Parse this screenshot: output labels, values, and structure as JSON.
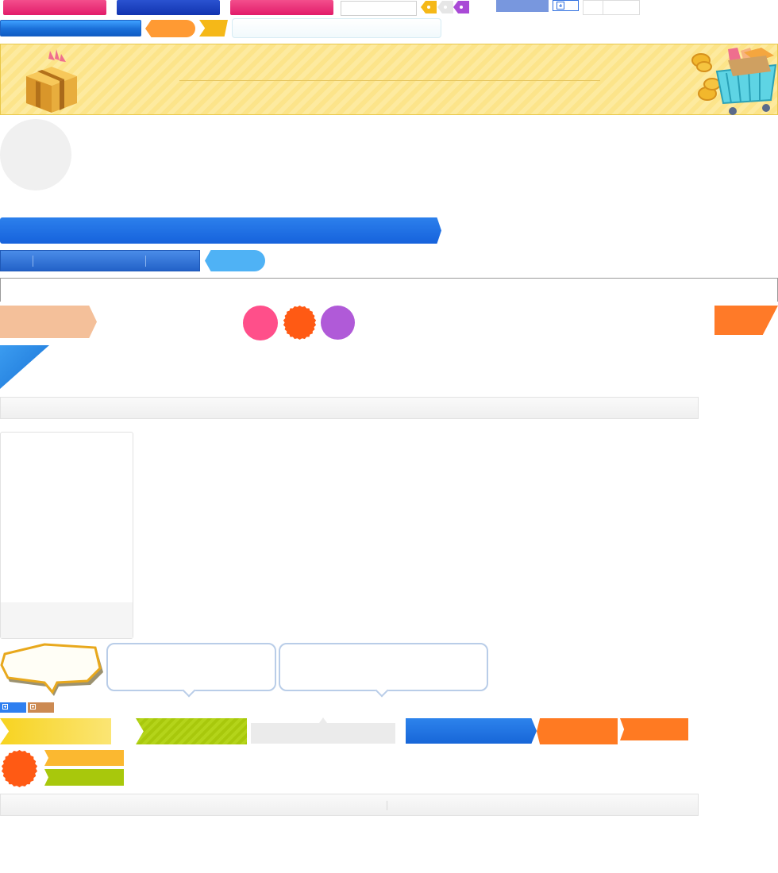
{
  "colors": {
    "pink": "#e21c6a",
    "blue": "#1234b0",
    "accent_blue": "#1a6fd8",
    "orange": "#ff7a22",
    "yellow": "#f5b818",
    "green": "#a8c80c",
    "purple": "#b05ad8",
    "banner_bg": "#fce48a"
  },
  "icons": {
    "gift": "gift-box-icon",
    "cart": "shopping-cart-icon",
    "plus": "plus-box-icon",
    "tag": "price-tag-icon"
  },
  "text": {
    "ribbon_pink_1": "",
    "ribbon_blue_1": "",
    "ribbon_pink_2": "",
    "search_value": "",
    "bar_blue": "",
    "pill_orange": "",
    "banner_title": "",
    "bar_big": "",
    "pill_lightblue": "",
    "bubble_1": "",
    "bubble_2": "",
    "flag_yellow": "",
    "flag_green": "",
    "btn_blue": "",
    "btn_orange": "",
    "btn_orange_2": ""
  }
}
